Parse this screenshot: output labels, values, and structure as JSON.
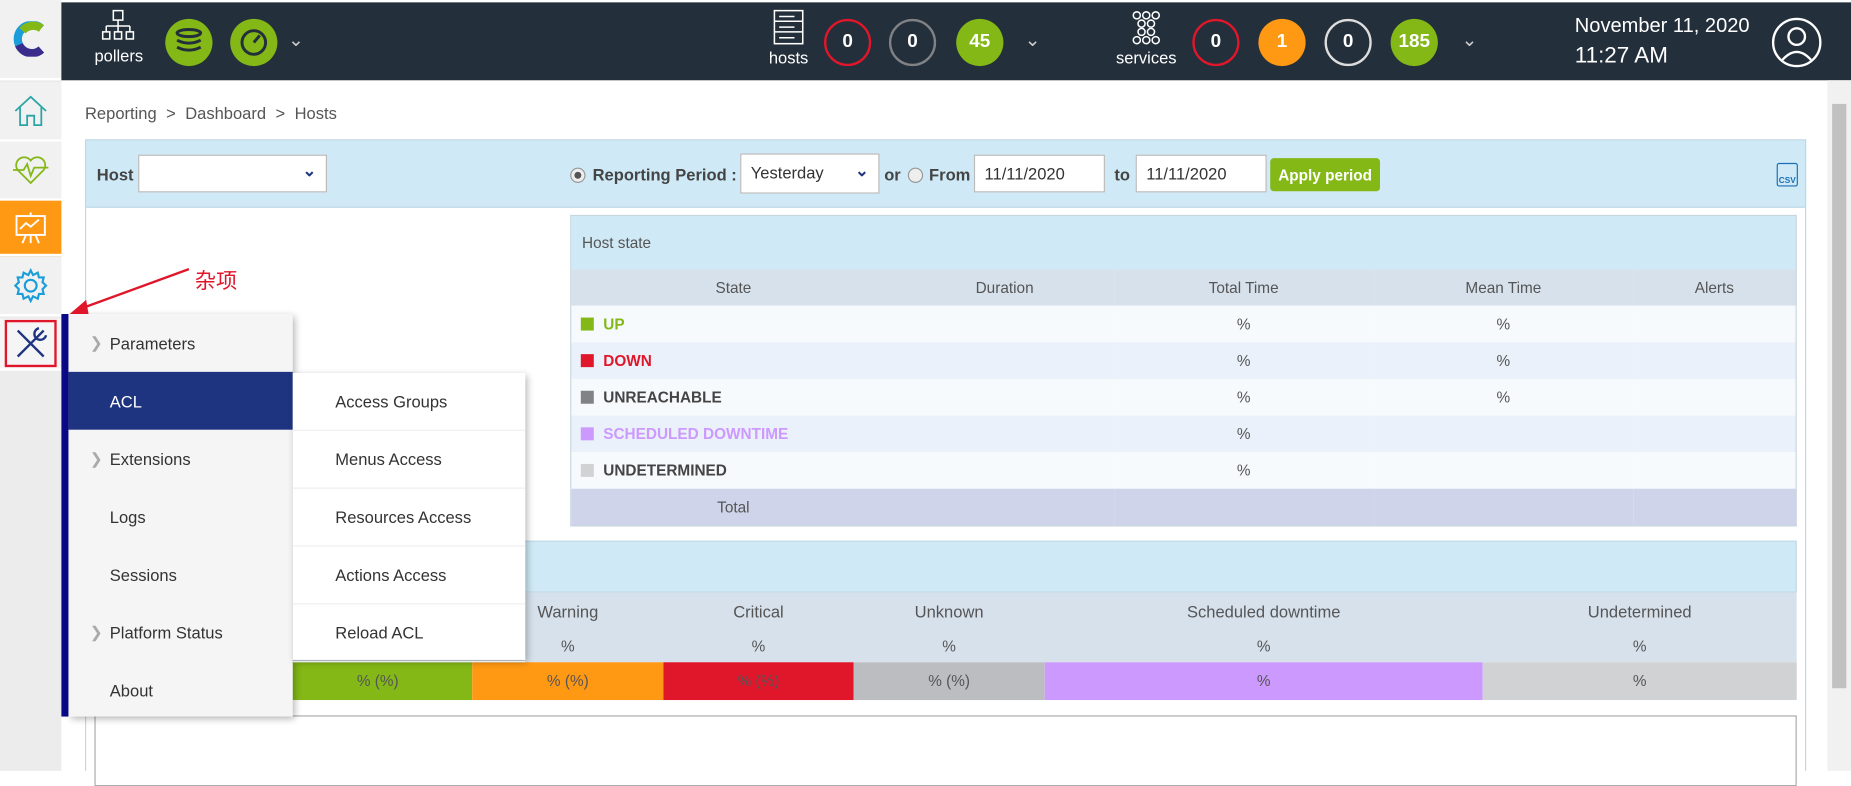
{
  "topbar": {
    "pollers_label": "pollers",
    "hosts_label": "hosts",
    "hosts_counts": {
      "down": "0",
      "unreachable": "0",
      "up": "45"
    },
    "services_label": "services",
    "services_counts": {
      "critical": "0",
      "warning": "1",
      "unknown": "0",
      "ok": "185"
    },
    "date": "November 11, 2020",
    "time": "11:27 AM"
  },
  "colors": {
    "topbar": "#232f3a",
    "green": "#84b817",
    "red": "#e0162b",
    "orange": "#ff9913",
    "active_menu": "#1e3480",
    "reporting": "#ff9913"
  },
  "sidebar": {
    "items": [
      {
        "icon": "home-icon"
      },
      {
        "icon": "heartbeat-icon"
      },
      {
        "icon": "reporting-icon",
        "active": true
      },
      {
        "icon": "gear-icon"
      },
      {
        "icon": "tools-icon",
        "highlighted": true
      }
    ]
  },
  "breadcrumb": [
    "Reporting",
    ">",
    "Dashboard",
    ">",
    "Hosts"
  ],
  "filter": {
    "host_label": "Host",
    "host_value": "",
    "reporting_period_label": "Reporting Period :",
    "period_value": "Yesterday",
    "or_label": "or",
    "from_label": "From",
    "from_value": "11/11/2020",
    "to_label": "to",
    "to_value": "11/11/2020",
    "apply_label": "Apply period",
    "csv_label": "CSV"
  },
  "host_state": {
    "title": "Host state",
    "columns": [
      "State",
      "Duration",
      "Total Time",
      "Mean Time",
      "Alerts"
    ],
    "rows": [
      {
        "state": "UP",
        "color": "#84b817",
        "total": "%",
        "mean": "%"
      },
      {
        "state": "DOWN",
        "color": "#e0162b",
        "total": "%",
        "mean": "%"
      },
      {
        "state": "UNREACHABLE",
        "color": "#818285",
        "total": "%",
        "mean": "%"
      },
      {
        "state": "SCHEDULED DOWNTIME",
        "color": "#cc99ff",
        "total": "%",
        "mean": ""
      },
      {
        "state": "UNDETERMINED",
        "color": "#d1d2d4",
        "total": "%",
        "mean": ""
      }
    ],
    "total_label": "Total"
  },
  "services": {
    "columns": [
      {
        "label": "Warning",
        "pct": "%",
        "bar": "% (%)",
        "color": "#ff9913"
      },
      {
        "label": "Critical",
        "pct": "%",
        "bar": "% (%)",
        "color": "#e0162b"
      },
      {
        "label": "Unknown",
        "pct": "%",
        "bar": "% (%)",
        "color": "#bcbdc0"
      },
      {
        "label": "Scheduled downtime",
        "pct": "%",
        "bar": "%",
        "color": "#cc99ff"
      },
      {
        "label": "Undetermined",
        "pct": "%",
        "bar": "%",
        "color": "#d1d2d4"
      }
    ],
    "ok_bar": "% (%)",
    "ok_color": "#84b817"
  },
  "menu": {
    "items": [
      "Parameters",
      "ACL",
      "Extensions",
      "Logs",
      "Sessions",
      "Platform Status",
      "About"
    ],
    "active": "ACL",
    "submenu": [
      "Access Groups",
      "Menus Access",
      "Resources Access",
      "Actions Access",
      "Reload ACL"
    ]
  },
  "annotation": {
    "text": "杂项"
  }
}
